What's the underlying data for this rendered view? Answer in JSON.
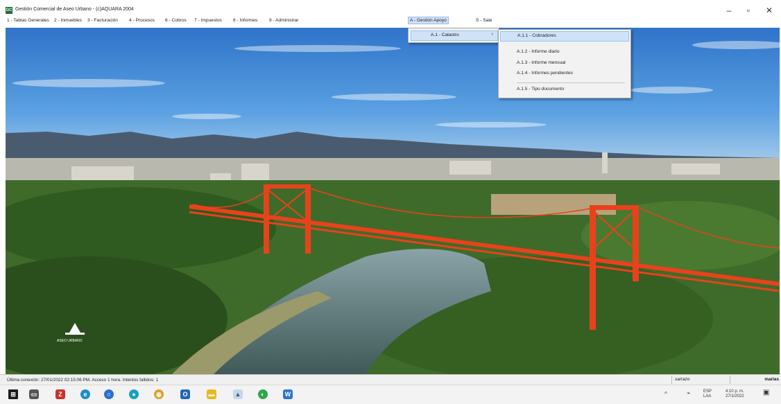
{
  "window": {
    "title": "Gestión Comercial de Aseo Urbano - (c)AQUARA 2004",
    "controls": {
      "minimize": "–",
      "maximize": "▫",
      "close": "✕"
    }
  },
  "menubar": {
    "items": [
      "1 - Tablas Generales",
      "2 - Inmuebles",
      "3 - Facturación",
      "4 - Procesos",
      "6 - Cobros",
      "7 - Impuestos",
      "8 - Informes",
      "9 - Administrar",
      "A - Gestión Apoyo",
      "S - Sale"
    ],
    "active_index": 8
  },
  "submenu_level1": {
    "label": "A.1 - Catastro",
    "arrow": "›"
  },
  "submenu_level2": {
    "items": [
      "A.1.1 - Cobradores",
      "A.1.2 - Informe diario",
      "A.1.3 - Informe mensual",
      "A.1.4 - Informes pendientes",
      "A.1.5 - Tipo documento"
    ],
    "selected_index": 0
  },
  "watermark": {
    "text": "ASEO URBANO"
  },
  "statusbar": {
    "message": "Última conexión: 27/01/2022 02:15:06 PM. Acceso 1 hora. Intentos fallidos: 1",
    "user": "sarrazo",
    "machine": "marlas"
  },
  "taskbar": {
    "tray_lang": "ESP",
    "tray_lang2": "LAA",
    "time": "4:10 p. m.",
    "date": "27/1/2022",
    "chevron": "^"
  },
  "colors": {
    "bridge": "#e8421c",
    "menu_highlight": "#cfe3f8",
    "sky": "#3f86d6"
  }
}
